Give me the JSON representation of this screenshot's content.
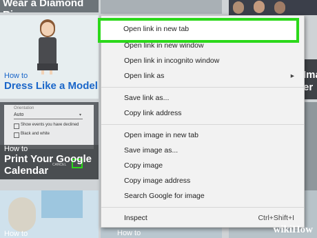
{
  "background_tiles": {
    "top_banner": "Wear a Diamond Ring",
    "tile_dress": {
      "howto": "How to",
      "title": "Dress Like a Model"
    },
    "tile_calendar": {
      "howto": "How to",
      "title_line1": "Print Your Google",
      "title_line2": "Calendar",
      "settings_label": "Orientation",
      "settings_value": "Auto",
      "checkbox1": "Show events you have declined",
      "checkbox2": "Black and white",
      "cancel": "CANCEL"
    },
    "tile_bottom_left": {
      "howto": "How to"
    },
    "tile_bottom_mid": {
      "howto": "How to"
    },
    "right_partial_text1": "Ima",
    "right_partial_text2": "er"
  },
  "context_menu": {
    "items": [
      {
        "label": "Open link in new tab"
      },
      {
        "label": "Open link in new window"
      },
      {
        "label": "Open link in incognito window"
      },
      {
        "label": "Open link as"
      },
      {
        "label": "Save link as..."
      },
      {
        "label": "Copy link address"
      },
      {
        "label": "Open image in new tab"
      },
      {
        "label": "Save image as..."
      },
      {
        "label": "Copy image"
      },
      {
        "label": "Copy image address"
      },
      {
        "label": "Search Google for image"
      },
      {
        "label": "Inspect",
        "shortcut": "Ctrl+Shift+I"
      }
    ],
    "submenu_arrow": "▸"
  },
  "watermark": "wikiHow",
  "colors": {
    "highlight": "#2bd81a",
    "howto_blue": "#1a66c9"
  }
}
